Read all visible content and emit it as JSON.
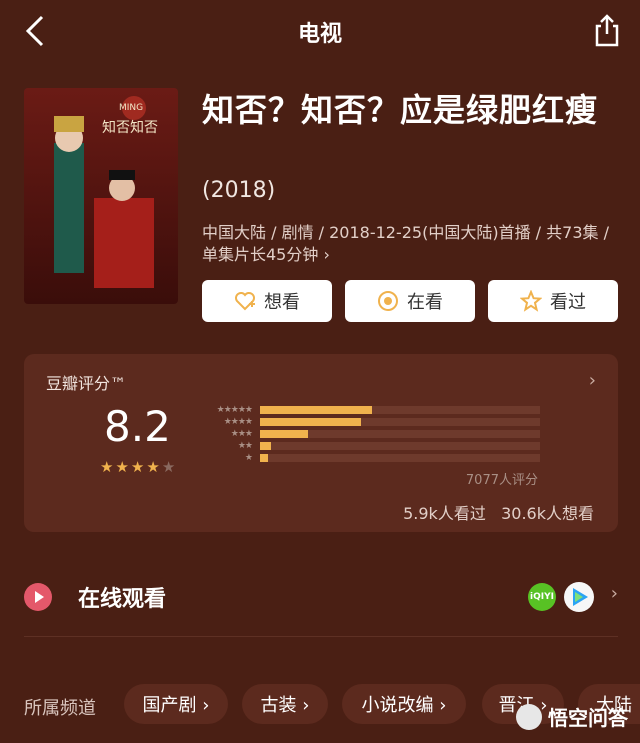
{
  "nav": {
    "title": "电视"
  },
  "movie": {
    "title": "知否？知否？应是绿肥红瘦",
    "year": "(2018)",
    "meta": "中国大陆 / 剧情 / 2018-12-25(中国大陆)首播 / 共73集 / 单集片长45分钟 ›"
  },
  "actions": {
    "want": "想看",
    "watching": "在看",
    "watched": "看过"
  },
  "rating": {
    "label": "豆瓣评分™",
    "score": "8.2",
    "stars_filled": 4,
    "stars_total": 5,
    "distribution_percent": [
      40,
      36,
      17,
      4,
      3
    ],
    "count": "7077人评分",
    "seen": "5.9k人看过",
    "want": "30.6k人想看"
  },
  "watch": {
    "label": "在线观看",
    "iqiyi": "iQIYI"
  },
  "channels": {
    "label": "所属频道",
    "items": [
      "国产剧 ›",
      "古装 ›",
      "小说改编 ›",
      "晋江 ›",
      "大陆"
    ]
  },
  "watermark": "悟空问答",
  "colors": {
    "background": "#4a1f14",
    "card": "#5c2a1e",
    "accent": "#f0b24d"
  },
  "icons": [
    "back-icon",
    "share-icon",
    "heart-plus-icon",
    "target-icon",
    "star-icon",
    "play-icon",
    "iqiyi-logo-icon",
    "tencent-video-icon"
  ]
}
